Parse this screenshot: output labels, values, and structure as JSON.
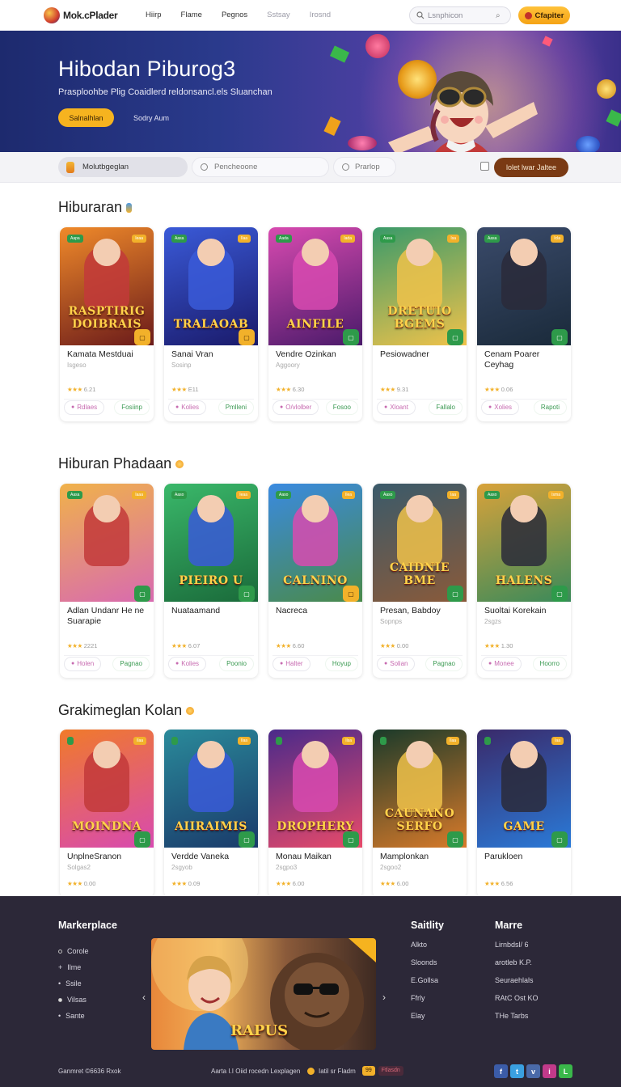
{
  "header": {
    "logo": "Mok.cPlader",
    "nav": [
      "Hiirp",
      "Flame",
      "Pegnos",
      "Sstsay",
      "Irosnd"
    ],
    "search_placeholder": "Lsnphicon",
    "cta": "Cfapiter"
  },
  "hero": {
    "title": "Hibodan Piburog3",
    "subtitle": "Prasploohbe Plig Coaidlerd reldonsancl.els Sluanchan",
    "primary_button": "Salnalhlan",
    "secondary_button": "Sodry Aum"
  },
  "filters": {
    "pill1": "Molutbgeglan",
    "pill2": "Pencheoone",
    "pill3": "Prarlop",
    "cta": "lolet lwar Jaltee"
  },
  "sections": [
    {
      "title": "Hiburaran",
      "cards": [
        {
          "thumb_text": "RASPTIRIG DOIBRAIS",
          "name": "Kamata Mestduai",
          "sub": "Isgeso",
          "rating": "6.21",
          "left_action": "Rdlaes",
          "right_action": "Fosiinp",
          "badge_l": "Aapa",
          "badge_r": "Ieaa"
        },
        {
          "thumb_text": "TRALAOAB",
          "name": "Sanai Vran",
          "sub": "Sosinp",
          "rating": "E11",
          "left_action": "Kolies",
          "right_action": "Pmlleni",
          "badge_l": "Aasa",
          "badge_r": "Ilaa"
        },
        {
          "thumb_text": "AINFILE",
          "name": "Vendre Ozinkan",
          "sub": "Aggoory",
          "rating": "6.30",
          "left_action": "O/vlolber",
          "right_action": "Fosoo",
          "badge_l": "Aada",
          "badge_r": "Iada"
        },
        {
          "thumb_text": "DRETUIO BGEMS",
          "name": "Pesiowadner",
          "sub": "",
          "rating": "9.31",
          "left_action": "Xloant",
          "right_action": "Fallalo",
          "badge_l": "Aasa",
          "badge_r": "Isa"
        },
        {
          "thumb_text": "",
          "name": "Cenam Poarer Ceyhag",
          "sub": "",
          "rating": "0.06",
          "left_action": "Xolies",
          "right_action": "Rapoti",
          "badge_l": "Aasa",
          "badge_r": "Icla"
        }
      ]
    },
    {
      "title": "Hiburan Phadaan",
      "cards": [
        {
          "thumb_text": "",
          "name": "Adlan Undanr He ne Suarapie",
          "sub": "",
          "rating": "2221",
          "left_action": "Holen",
          "right_action": "Pagnao",
          "badge_l": "Aasa",
          "badge_r": "Iaaa"
        },
        {
          "thumb_text": "PIEIRO U",
          "name": "Nuataamand",
          "sub": "",
          "rating": "6.07",
          "left_action": "Kolies",
          "right_action": "Poonio",
          "badge_l": "Aaso",
          "badge_r": "Ieaa"
        },
        {
          "thumb_text": "CALNINO",
          "name": "Nacreca",
          "sub": "",
          "rating": "6.60",
          "left_action": "Halter",
          "right_action": "Hoyup",
          "badge_l": "Aaso",
          "badge_r": "Ilea"
        },
        {
          "thumb_text": "CAIDNIE BME",
          "name": "Presan, Babdoy",
          "sub": "Sopnps",
          "rating": "0.00",
          "left_action": "Solian",
          "right_action": "Pagnao",
          "badge_l": "Aaso",
          "badge_r": "Iaa"
        },
        {
          "thumb_text": "HALENS",
          "name": "Suoltai Korekain",
          "sub": "2sgzs",
          "rating": "1.30",
          "left_action": "Monee",
          "right_action": "Hoorro",
          "badge_l": "Aaso",
          "badge_r": "Isma"
        }
      ]
    },
    {
      "title": "Grakimeglan Kolan",
      "cards": [
        {
          "thumb_text": "MOINDNA",
          "name": "UnplneSranon",
          "sub": "Solgas2",
          "rating": "0.00",
          "left_action": "",
          "right_action": "",
          "badge_l": "",
          "badge_r": "Ilaa"
        },
        {
          "thumb_text": "AIIRAIMIS",
          "name": "Verdde Vaneka",
          "sub": "2sgyob",
          "rating": "0.09",
          "left_action": "",
          "right_action": "",
          "badge_l": "",
          "badge_r": "Ilaa"
        },
        {
          "thumb_text": "DROPHERY",
          "name": "Monau Maikan",
          "sub": "2sgpo3",
          "rating": "6.00",
          "left_action": "",
          "right_action": "",
          "badge_l": "",
          "badge_r": "Ilsa"
        },
        {
          "thumb_text": "CAUNANO SERFO",
          "name": "Mamplonkan",
          "sub": "2sgoo2",
          "rating": "6.00",
          "left_action": "",
          "right_action": "",
          "badge_l": "",
          "badge_r": "Ilaa"
        },
        {
          "thumb_text": "GAME",
          "name": "Parukloen",
          "sub": "",
          "rating": "6.56",
          "left_action": "",
          "right_action": "",
          "badge_l": "",
          "badge_r": "Iaa"
        }
      ]
    }
  ],
  "footer": {
    "col1_title": "Markerplace",
    "col1_items": [
      "Corole",
      "Ilme",
      "Ssile",
      "Vilsas",
      "Sante"
    ],
    "banner_text": "RAPUS",
    "banner_ribbon": "",
    "col2_title": "Saitlity",
    "col2_items": [
      "Alkto",
      "Sloonds",
      "E.Gollsa",
      "Ffrly",
      "Elay"
    ],
    "col3_title": "Marre",
    "col3_items": [
      "Lirnbdsl/ 6",
      "arotleb K.P.",
      "Seuraehlals",
      "RAtC Ost KO",
      "THe Tarbs"
    ],
    "copyright": "Ganmret ©6636 Rxok",
    "bottom_center": "Aarta I.I Oiid rocedn Lexplagen",
    "bottom_after": "Iatil sr Fladm",
    "tag1": "99",
    "tag2": "Ftlasdn"
  },
  "colors": {
    "accent": "#f6b31f",
    "footer_bg": "#2c2838",
    "hero_bg": "#2a3a8c",
    "cta_brown": "#7a3a14",
    "green": "#2e9a4a"
  }
}
